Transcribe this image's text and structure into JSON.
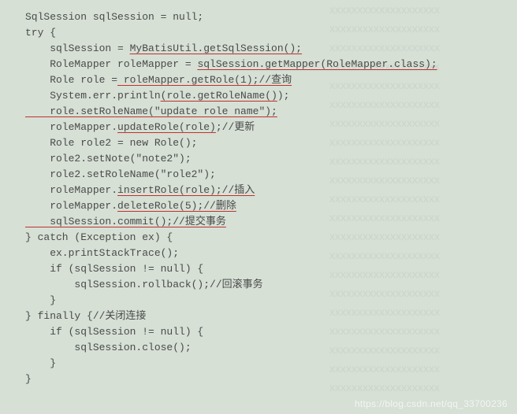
{
  "code": {
    "l01": "SqlSession sqlSession = null;",
    "l02": "try {",
    "l03a": "    sqlSession = ",
    "l03b": "MyBatisUtil.getSqlSession();",
    "l04a": "    RoleMapper roleMapper = ",
    "l04b": "sqlSession.getMapper(RoleMapper.class);",
    "l05a": "    Role role =",
    "l05b": " roleMapper.getRole(1);//查询",
    "l06a": "    System.err.println",
    "l06b": "(role.getRoleName()",
    "l06c": ");",
    "l07": "    role.setRoleName(\"update role name\");",
    "l08a": "    roleMapper.",
    "l08b": "updateRole(role)",
    "l08c": ";//更新",
    "l09": "    Role role2 = new Role();",
    "l10": "    role2.setNote(\"note2\");",
    "l11": "    role2.setRoleName(\"role2\");",
    "l12a": "    roleMapper.",
    "l12b": "insertRole(role);//插入",
    "l13a": "    roleMapper.",
    "l13b": "deleteRole(5);//删除",
    "l14": "    sqlSession.commit();//提交事务",
    "l15": "} catch (Exception ex) {",
    "l16": "    ex.printStackTrace();",
    "l17": "    if (sqlSession != null) {",
    "l18": "        sqlSession.rollback();//回滚事务",
    "l19": "    }",
    "l20": "} finally {//关闭连接",
    "l21": "    if (sqlSession != null) {",
    "l22": "        sqlSession.close();",
    "l23": "    }",
    "l24": "}"
  },
  "watermark": "https://blog.csdn.net/qq_33700236"
}
